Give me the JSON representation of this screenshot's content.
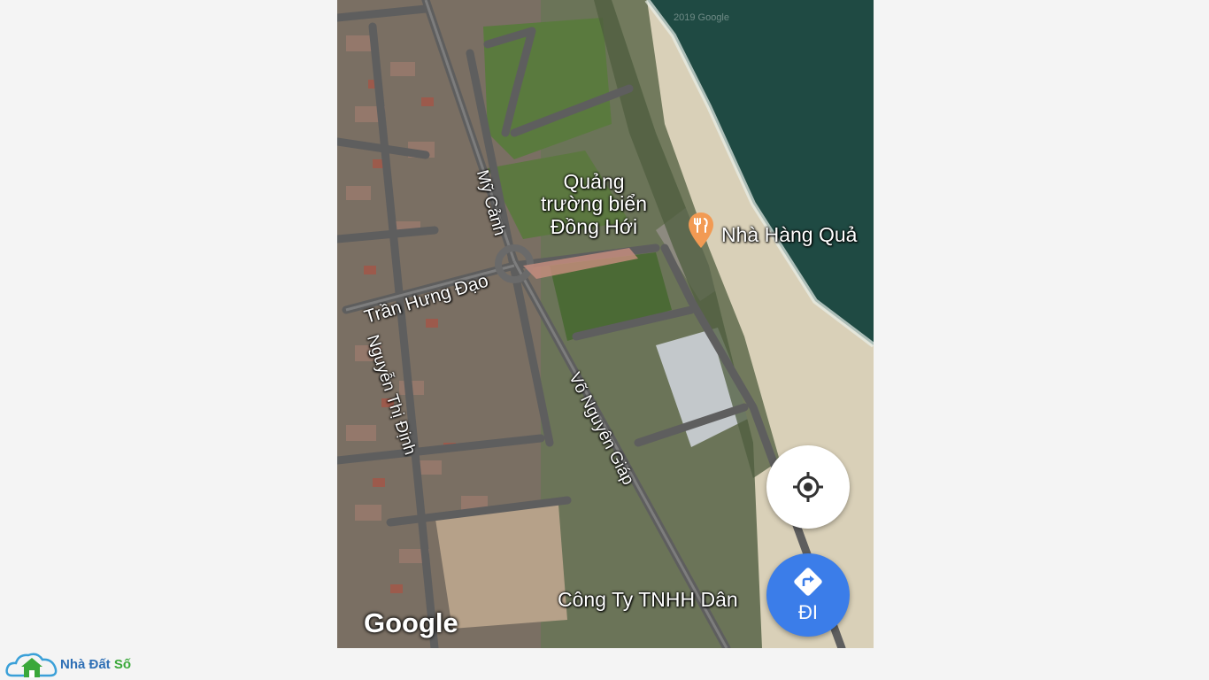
{
  "map": {
    "roads": {
      "my_canh": "Mỹ Cảnh",
      "tran_hung_dao": "Trần Hưng Đạo",
      "nguyen_thi_dinh": "Nguyễn Thị Định",
      "vo_nguyen_giap": "Võ Nguyên Giáp"
    },
    "place_label": [
      "Quảng",
      "trường biển",
      "Đồng Hới"
    ],
    "poi_restaurant": "Nhà Hàng Quả",
    "company_label": "Công Ty TNHH Dân",
    "google_logo": "Google",
    "watermark": "2019 Google",
    "poi_icon": "fork-knife-icon",
    "colors": {
      "sea": "#1f4a43",
      "sand": "#d9d0b8",
      "road": "#5e5e5e",
      "poi": "#f29a53",
      "accent": "#3b7de9"
    }
  },
  "controls": {
    "my_location_icon": "crosshair-icon",
    "directions_icon": "directions-icon",
    "directions_label": "ĐI"
  },
  "brand": {
    "name_part1": "Nhà Đất ",
    "name_part2": "Số"
  }
}
